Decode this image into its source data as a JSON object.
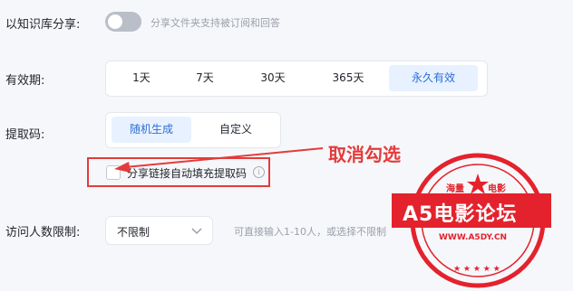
{
  "share": {
    "label": "以知识库分享:",
    "toggle_on": false,
    "hint": "分享文件夹支持被订阅和回答"
  },
  "validity": {
    "label": "有效期:",
    "options": [
      "1天",
      "7天",
      "30天",
      "365天",
      "永久有效"
    ],
    "selected": "永久有效"
  },
  "code": {
    "label": "提取码:",
    "options": [
      "随机生成",
      "自定义"
    ],
    "selected": "随机生成",
    "autofill_label": "分享链接自动填充提取码",
    "autofill_checked": false,
    "info_icon": "i"
  },
  "annotation": {
    "text": "取消勾选",
    "color": "#e43b3b"
  },
  "visitors": {
    "label": "访问人数限制:",
    "value": "不限制",
    "hint": "可直接输入1-10人，或选择不限制"
  },
  "watermark": {
    "top_text": "海量",
    "top_text2": "电影",
    "banner": "A5电影论坛",
    "url": "WWW.A5DY.CN",
    "color": "#e4222d"
  }
}
